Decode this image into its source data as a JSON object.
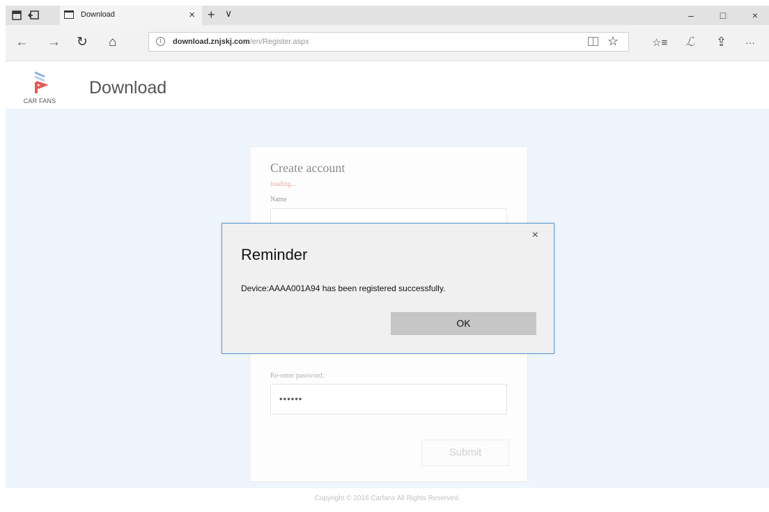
{
  "browser": {
    "tab": {
      "title": "Download",
      "close_glyph": "×"
    },
    "new_tab_glyph": "+",
    "tab_menu_glyph": "∨",
    "window_controls": {
      "minimize": "–",
      "maximize": "□",
      "close": "×"
    },
    "nav": {
      "back": "←",
      "forward": "→",
      "refresh": "↻",
      "home": "⌂"
    },
    "address": {
      "info_icon": "i",
      "domain": "download.znjskj.com",
      "path": "/en/Register.aspx"
    },
    "toolbar": {
      "favorite_star": "☆",
      "favorites_hub": "☆≡",
      "notes": "ℒ",
      "share": "⇪",
      "more": "···"
    }
  },
  "site": {
    "logo_text": "CAR FANS",
    "title": "Download"
  },
  "form": {
    "title": "Create account",
    "status": "loading...",
    "name_label": "Name",
    "reenter_password_label": "Re-enter password:",
    "reenter_password_value": "••••••",
    "submit_label": "Submit"
  },
  "footer": {
    "text": "Copyright © 2016 Carfans All Rights Reserved."
  },
  "modal": {
    "close_glyph": "×",
    "title": "Reminder",
    "message": "Device:AAAA001A94 has been registered successfully.",
    "ok_label": "OK"
  },
  "colors": {
    "page_background": "#eef5fc",
    "modal_border": "#5b9bd5",
    "ok_button": "#c6c6c6",
    "loading_text": "#f0a8a8",
    "logo_red": "#e25a5a",
    "logo_blue": "#8fb0e0"
  }
}
